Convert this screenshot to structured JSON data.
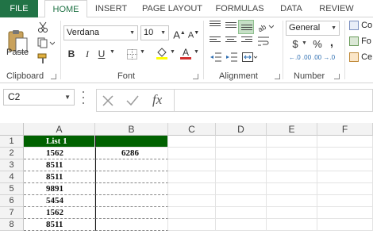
{
  "tabs": {
    "file": "FILE",
    "home": "HOME",
    "insert": "INSERT",
    "page_layout": "PAGE LAYOUT",
    "formulas": "FORMULAS",
    "data": "DATA",
    "review": "REVIEW"
  },
  "ribbon": {
    "paste_label": "Paste",
    "clipboard_label": "Clipboard",
    "font_label": "Font",
    "alignment_label": "Alignment",
    "number_label": "Number",
    "font_name": "Verdana",
    "font_size": "10",
    "number_format": "General",
    "grow_font": "A",
    "shrink_font": "A",
    "bold": "B",
    "italic": "I",
    "underline": "U",
    "currency": "$",
    "percent": "%",
    "comma": ",",
    "inc_decimal": "←.0 .00",
    "dec_decimal": ".00 →.0",
    "styles_1": "Co",
    "styles_2": "Fo",
    "styles_3": "Ce",
    "accent_color": "#217346",
    "font_color": "#d32f2f",
    "highlight_color": "#ffff00"
  },
  "formula_bar": {
    "name_box": "C2",
    "fx": "fx",
    "formula": ""
  },
  "sheet": {
    "columns": [
      "A",
      "B",
      "C",
      "D",
      "E",
      "F"
    ],
    "rows": [
      "1",
      "2",
      "3",
      "4",
      "5",
      "6",
      "7",
      "8"
    ],
    "header_fill": "#006100",
    "col_a": [
      "List 1",
      "1562",
      "8511",
      "8511",
      "9891",
      "5454",
      "1562",
      "8511"
    ],
    "col_b": [
      "",
      "6286",
      "",
      "",
      "",
      "",
      "",
      ""
    ]
  }
}
